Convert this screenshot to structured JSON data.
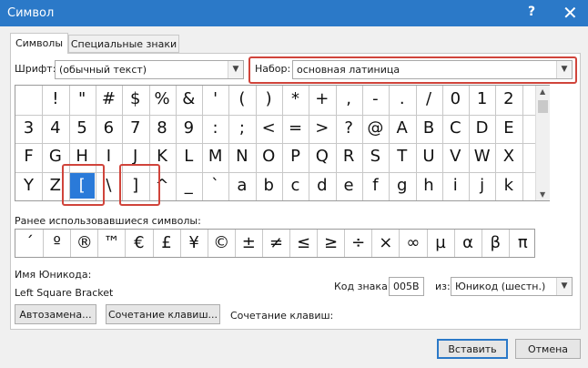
{
  "window": {
    "title": "Символ",
    "help_label": "?",
    "close_label": "✕"
  },
  "tabs": [
    {
      "label": "Символы",
      "selected": true
    },
    {
      "label": "Специальные знаки",
      "selected": false
    }
  ],
  "font": {
    "label": "Шрифт:",
    "value": "(обычный текст)"
  },
  "subset": {
    "label": "Набор:",
    "value": "основная латиница"
  },
  "grid": {
    "rows": [
      [
        "",
        "!",
        "\"",
        "#",
        "$",
        "%",
        "&",
        "'",
        "(",
        ")",
        "*",
        "+",
        ",",
        "-",
        ".",
        "/",
        "0",
        "1",
        "2"
      ],
      [
        "3",
        "4",
        "5",
        "6",
        "7",
        "8",
        "9",
        ":",
        ";",
        "<",
        "=",
        ">",
        "?",
        "@",
        "A",
        "B",
        "C",
        "D",
        "E"
      ],
      [
        "F",
        "G",
        "H",
        "I",
        "J",
        "K",
        "L",
        "M",
        "N",
        "O",
        "P",
        "Q",
        "R",
        "S",
        "T",
        "U",
        "V",
        "W",
        "X"
      ],
      [
        "Y",
        "Z",
        "[",
        "\\",
        "]",
        "^",
        "_",
        "`",
        "a",
        "b",
        "c",
        "d",
        "e",
        "f",
        "g",
        "h",
        "i",
        "j",
        "k"
      ]
    ],
    "selected": {
      "row": 3,
      "col": 2
    }
  },
  "recent": {
    "label": "Ранее использовавшиеся символы:",
    "symbols": [
      "´",
      "º",
      "®",
      "™",
      "€",
      "£",
      "¥",
      "©",
      "±",
      "≠",
      "≤",
      "≥",
      "÷",
      "×",
      "∞",
      "µ",
      "α",
      "β",
      "π"
    ]
  },
  "unicode_name": {
    "label": "Имя Юникода:",
    "value": "Left Square Bracket"
  },
  "char_code": {
    "label": "Код знака:",
    "value": "005B"
  },
  "from": {
    "label": "из:",
    "value": "Юникод (шестн.)"
  },
  "buttons": {
    "autocorrect": "Автозамена...",
    "shortcut_key": "Сочетание клавиш...",
    "insert": "Вставить",
    "cancel": "Отмена"
  },
  "shortcut_label": "Сочетание клавиш:",
  "colors": {
    "titlebar": "#2b79c8",
    "selection": "#2a7ad9",
    "highlight": "#d0443b"
  }
}
